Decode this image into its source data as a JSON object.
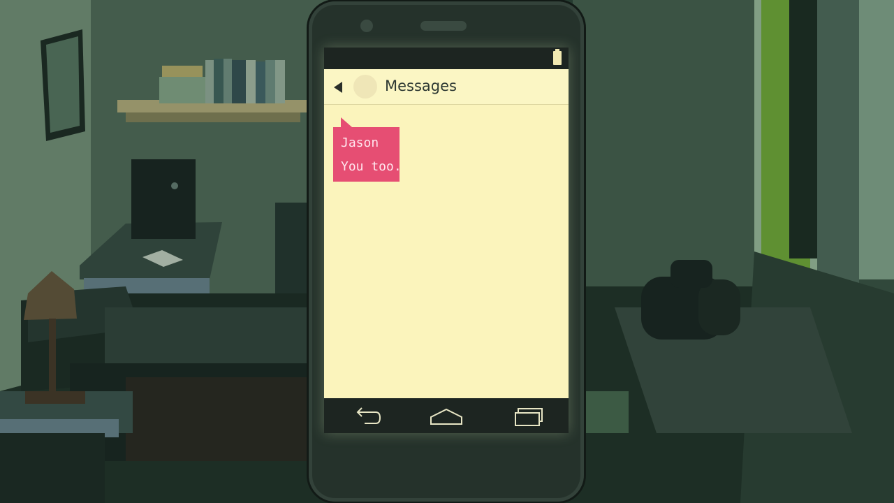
{
  "app": {
    "title": "Messages"
  },
  "conversation": {
    "messages": [
      {
        "sender": "Jason",
        "text": "You too."
      }
    ]
  },
  "icons": {
    "back": "back-chevron-icon",
    "status_battery": "battery-icon",
    "nav_back": "back-arrow-icon",
    "nav_home": "home-icon",
    "nav_recents": "recent-apps-icon"
  },
  "colors": {
    "screen_bg": "#fbf4bc",
    "bubble": "#e64e73",
    "bubble_text": "#ffe6ee",
    "bars": "#1d2521",
    "scene_tint": "#2c4536"
  }
}
